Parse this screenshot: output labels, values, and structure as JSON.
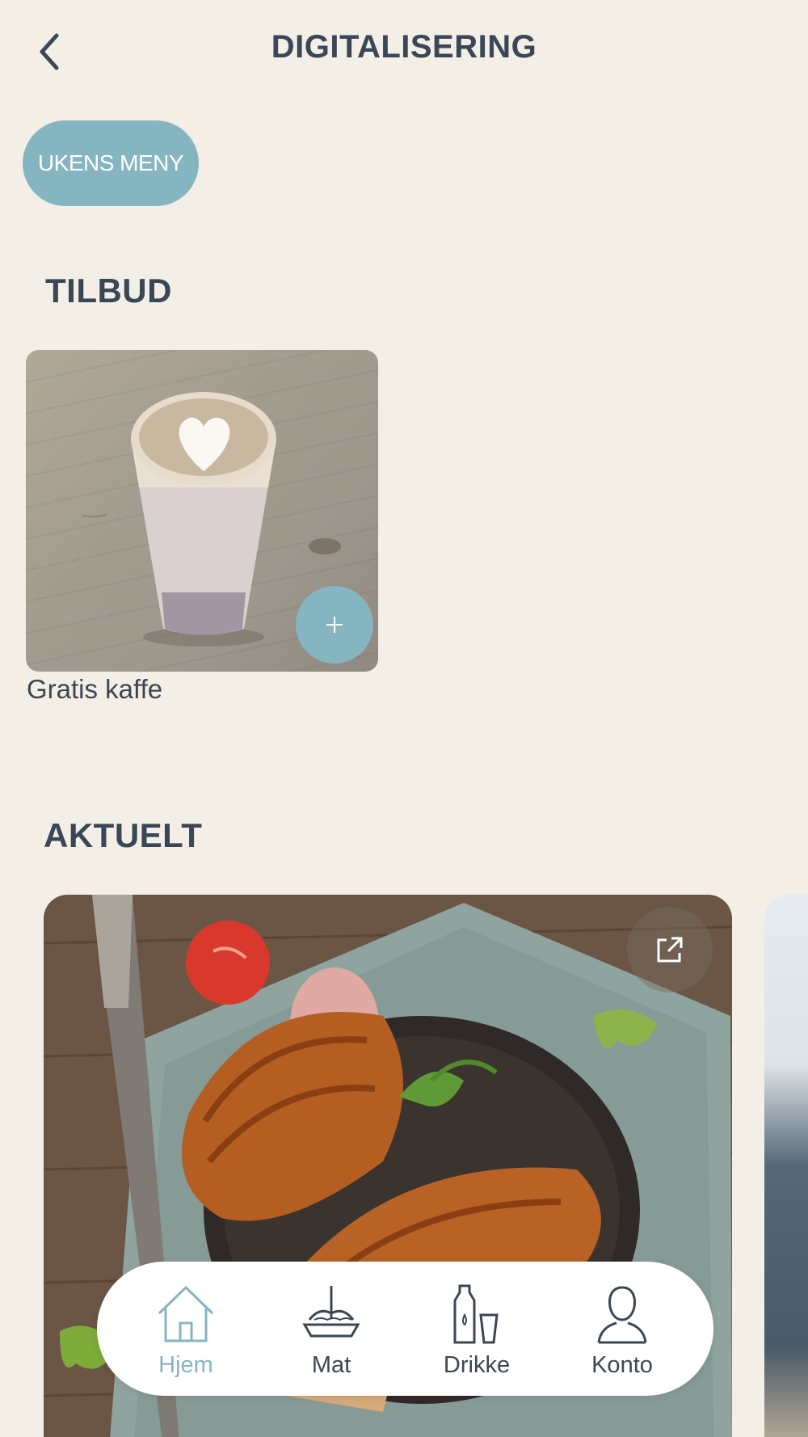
{
  "header": {
    "title": "DIGITALISERING"
  },
  "quick_filter": {
    "label": "UKENS MENY"
  },
  "sections": {
    "tilbud": "TILBUD",
    "aktuelt": "AKTUELT"
  },
  "offers": [
    {
      "name": "Gratis kaffe",
      "add_icon": "+"
    }
  ],
  "tabbar": {
    "tabs": [
      {
        "label": "Hjem",
        "icon": "home-icon",
        "active": true
      },
      {
        "label": "Mat",
        "icon": "food-bowl-icon",
        "active": false
      },
      {
        "label": "Drikke",
        "icon": "drink-bottle-icon",
        "active": false
      },
      {
        "label": "Konto",
        "icon": "person-icon",
        "active": false
      }
    ]
  },
  "colors": {
    "background": "#f4efe6",
    "accent": "#86b5c2",
    "text": "#3a4756"
  }
}
